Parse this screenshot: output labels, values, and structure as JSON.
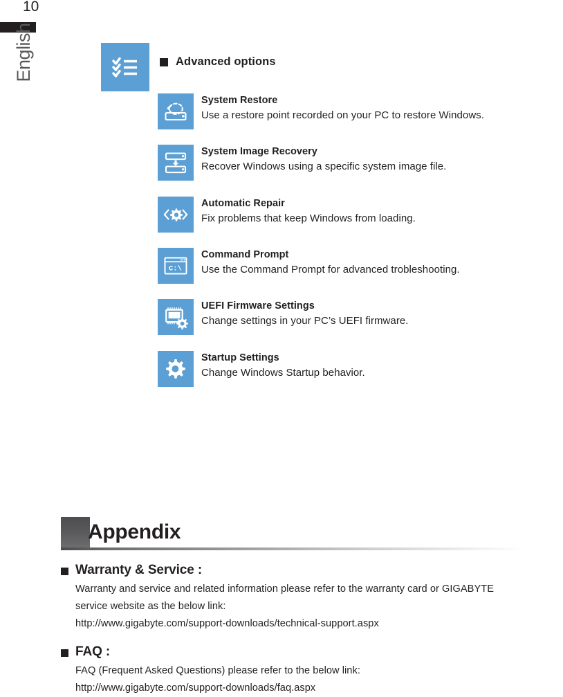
{
  "page": {
    "number": "10",
    "language_tab": "English",
    "accent_blue": "#5b9fd4",
    "text_color": "#231f20"
  },
  "advanced_options": {
    "icon_name": "checklist-icon",
    "title": "Advanced options",
    "items": [
      {
        "icon_name": "system-restore-icon",
        "title": "System Restore",
        "description": "Use a restore point recorded on your PC to restore Windows."
      },
      {
        "icon_name": "system-image-recovery-icon",
        "title": "System Image Recovery",
        "description": "Recover Windows using a specific system image file."
      },
      {
        "icon_name": "automatic-repair-icon",
        "title": "Automatic Repair",
        "description": "Fix problems that keep Windows from loading."
      },
      {
        "icon_name": "command-prompt-icon",
        "title": "Command Prompt",
        "description": "Use the Command Prompt for advanced trobleshooting."
      },
      {
        "icon_name": "uefi-firmware-settings-icon",
        "title": "UEFI Firmware Settings",
        "description": "Change settings in your PC’s UEFI firmware."
      },
      {
        "icon_name": "startup-settings-icon",
        "title": "Startup Settings",
        "description": "Change Windows Startup behavior."
      }
    ]
  },
  "appendix": {
    "title": "Appendix",
    "sections": [
      {
        "heading": "Warranty & Service :",
        "lines": [
          "Warranty and service and related information please refer to the warranty card or GIGABYTE",
          "service website as the below link:",
          "http://www.gigabyte.com/support-downloads/technical-support.aspx"
        ]
      },
      {
        "heading": "FAQ :",
        "lines": [
          "FAQ (Frequent Asked Questions) please refer to the below link:",
          "http://www.gigabyte.com/support-downloads/faq.aspx"
        ]
      }
    ]
  }
}
